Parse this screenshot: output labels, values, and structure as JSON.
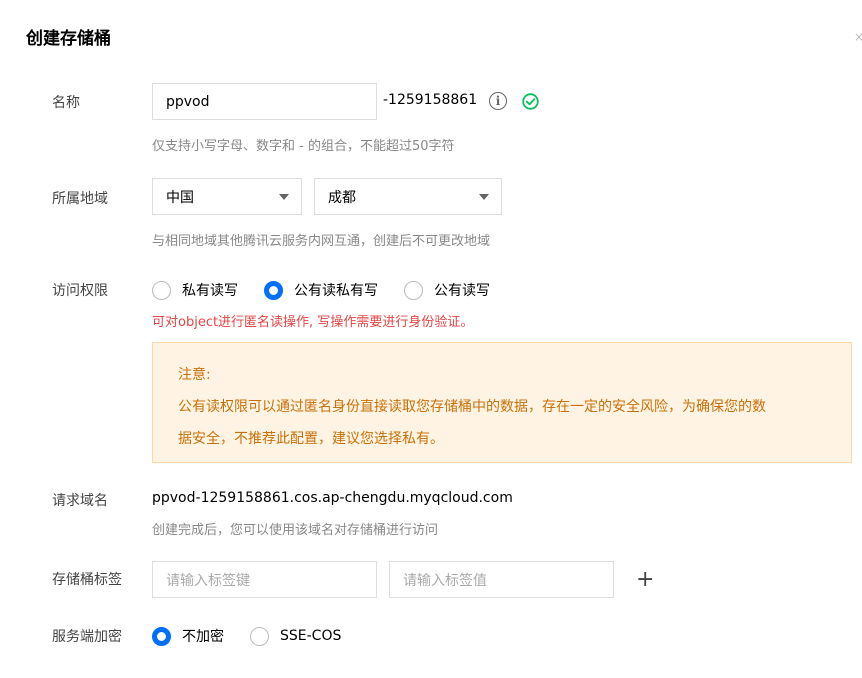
{
  "dialog": {
    "title": "创建存储桶",
    "close_glyph": "×"
  },
  "name": {
    "label": "名称",
    "value": "ppvod",
    "suffix": "-1259158861",
    "info_icon": "info-icon",
    "status_icon": "check-circle-icon",
    "help": "仅支持小写字母、数字和 - 的组合，不能超过50字符"
  },
  "region": {
    "label": "所属地域",
    "country": "中国",
    "city": "成都",
    "help": "与相同地域其他腾讯云服务内网互通，创建后不可更改地域"
  },
  "access": {
    "label": "访问权限",
    "options": [
      "私有读写",
      "公有读私有写",
      "公有读写"
    ],
    "selected_index": 1,
    "warning": "可对object进行匿名读操作, 写操作需要进行身份验证。",
    "notice_title": "注意:",
    "notice_line1": "公有读权限可以通过匿名身份直接读取您存储桶中的数据，存在一定的安全风险，为确保您的数",
    "notice_line2": "据安全，不推荐此配置，建议您选择私有。"
  },
  "domain": {
    "label": "请求域名",
    "value": "ppvod-1259158861.cos.ap-chengdu.myqcloud.com",
    "help": "创建完成后，您可以使用该域名对存储桶进行访问"
  },
  "tags": {
    "label": "存储桶标签",
    "key_placeholder": "请输入标签键",
    "value_placeholder": "请输入标签值",
    "add_glyph": "+"
  },
  "encryption": {
    "label": "服务端加密",
    "options": [
      "不加密",
      "SSE-COS"
    ],
    "selected_index": 0
  },
  "colors": {
    "primary": "#006eff",
    "success": "#0abf5b",
    "error": "#e54545",
    "notice_bg": "#fff4e3",
    "notice_text": "#c9700a"
  }
}
